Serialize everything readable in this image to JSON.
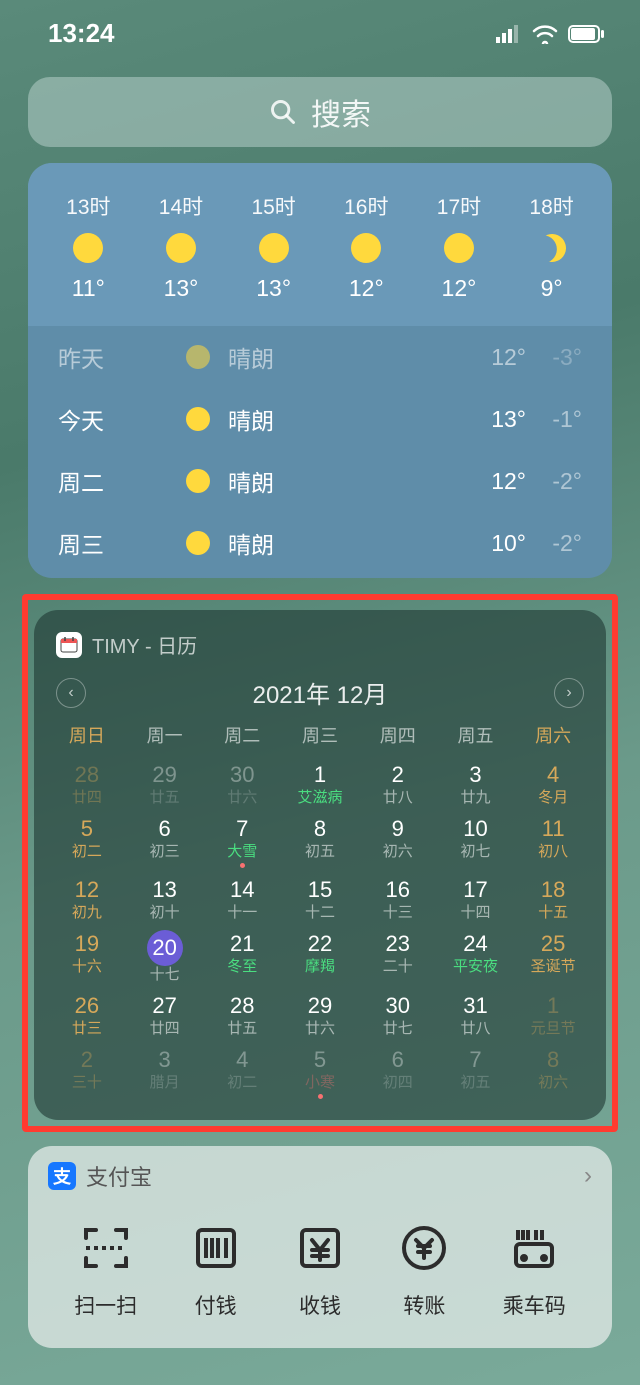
{
  "statusbar": {
    "time": "13:24"
  },
  "search": {
    "label": "搜索"
  },
  "weather": {
    "hourly": [
      {
        "time": "13时",
        "icon": "sun",
        "temp": "11°"
      },
      {
        "time": "14时",
        "icon": "sun",
        "temp": "13°"
      },
      {
        "time": "15时",
        "icon": "sun",
        "temp": "13°"
      },
      {
        "time": "16时",
        "icon": "sun",
        "temp": "12°"
      },
      {
        "time": "17时",
        "icon": "sun",
        "temp": "12°"
      },
      {
        "time": "18时",
        "icon": "moon",
        "temp": "9°"
      }
    ],
    "daily": [
      {
        "name": "昨天",
        "cond": "晴朗",
        "hi": "12°",
        "lo": "-3°",
        "dim": true
      },
      {
        "name": "今天",
        "cond": "晴朗",
        "hi": "13°",
        "lo": "-1°",
        "dim": false
      },
      {
        "name": "周二",
        "cond": "晴朗",
        "hi": "12°",
        "lo": "-2°",
        "dim": false
      },
      {
        "name": "周三",
        "cond": "晴朗",
        "hi": "10°",
        "lo": "-2°",
        "dim": false
      }
    ]
  },
  "calendar": {
    "app_label": "TIMY - 日历",
    "month_title": "2021年 12月",
    "weekdays": [
      "周日",
      "周一",
      "周二",
      "周三",
      "周四",
      "周五",
      "周六"
    ],
    "rows": [
      [
        {
          "n": "28",
          "s": "廿四",
          "out": true,
          "we": true
        },
        {
          "n": "29",
          "s": "廿五",
          "out": true
        },
        {
          "n": "30",
          "s": "廿六",
          "out": true
        },
        {
          "n": "1",
          "s": "艾滋病",
          "sc": "green"
        },
        {
          "n": "2",
          "s": "廿八"
        },
        {
          "n": "3",
          "s": "廿九"
        },
        {
          "n": "4",
          "s": "冬月",
          "we": true
        }
      ],
      [
        {
          "n": "5",
          "s": "初二",
          "we": true
        },
        {
          "n": "6",
          "s": "初三"
        },
        {
          "n": "7",
          "s": "大雪",
          "sc": "green",
          "dot": true
        },
        {
          "n": "8",
          "s": "初五"
        },
        {
          "n": "9",
          "s": "初六"
        },
        {
          "n": "10",
          "s": "初七"
        },
        {
          "n": "11",
          "s": "初八",
          "we": true
        }
      ],
      [
        {
          "n": "12",
          "s": "初九",
          "we": true
        },
        {
          "n": "13",
          "s": "初十"
        },
        {
          "n": "14",
          "s": "十一"
        },
        {
          "n": "15",
          "s": "十二"
        },
        {
          "n": "16",
          "s": "十三"
        },
        {
          "n": "17",
          "s": "十四"
        },
        {
          "n": "18",
          "s": "十五",
          "we": true
        }
      ],
      [
        {
          "n": "19",
          "s": "十六",
          "we": true
        },
        {
          "n": "20",
          "s": "十七",
          "today": true
        },
        {
          "n": "21",
          "s": "冬至",
          "sc": "green"
        },
        {
          "n": "22",
          "s": "摩羯",
          "sc": "green"
        },
        {
          "n": "23",
          "s": "二十"
        },
        {
          "n": "24",
          "s": "平安夜",
          "sc": "green"
        },
        {
          "n": "25",
          "s": "圣诞节",
          "sc": "green",
          "we": true
        }
      ],
      [
        {
          "n": "26",
          "s": "廿三",
          "we": true
        },
        {
          "n": "27",
          "s": "廿四"
        },
        {
          "n": "28",
          "s": "廿五"
        },
        {
          "n": "29",
          "s": "廿六"
        },
        {
          "n": "30",
          "s": "廿七"
        },
        {
          "n": "31",
          "s": "廿八"
        },
        {
          "n": "1",
          "s": "元旦节",
          "sc": "red",
          "out": true,
          "we": true
        }
      ],
      [
        {
          "n": "2",
          "s": "三十",
          "out": true,
          "we": true
        },
        {
          "n": "3",
          "s": "腊月",
          "out": true
        },
        {
          "n": "4",
          "s": "初二",
          "out": true
        },
        {
          "n": "5",
          "s": "小寒",
          "sc": "red",
          "out": true,
          "dot": true
        },
        {
          "n": "6",
          "s": "初四",
          "out": true
        },
        {
          "n": "7",
          "s": "初五",
          "out": true
        },
        {
          "n": "8",
          "s": "初六",
          "out": true,
          "we": true
        }
      ]
    ]
  },
  "alipay": {
    "title": "支付宝",
    "actions": [
      {
        "key": "scan",
        "label": "扫一扫"
      },
      {
        "key": "pay",
        "label": "付钱"
      },
      {
        "key": "collect",
        "label": "收钱"
      },
      {
        "key": "transfer",
        "label": "转账"
      },
      {
        "key": "transit",
        "label": "乘车码"
      }
    ]
  }
}
